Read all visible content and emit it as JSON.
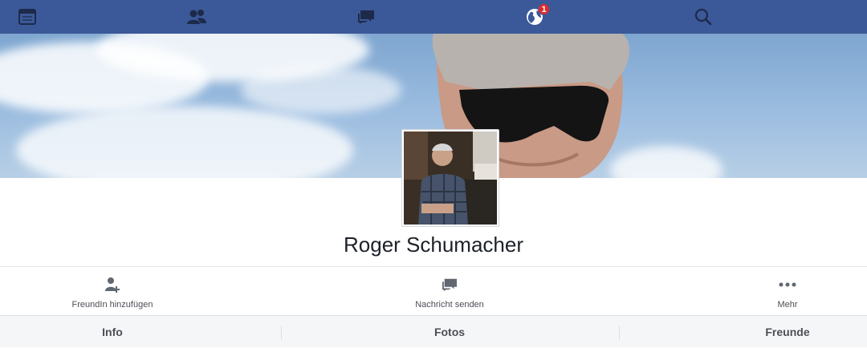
{
  "nav": {
    "items": [
      {
        "icon": "news-feed-icon"
      },
      {
        "icon": "friend-requests-icon"
      },
      {
        "icon": "messages-icon"
      },
      {
        "icon": "notifications-globe-icon",
        "badge": "1"
      },
      {
        "icon": "search-icon"
      }
    ],
    "background": "#3b5998"
  },
  "profile": {
    "name": "Roger Schumacher"
  },
  "actions": {
    "add_friend": "FreundIn hinzufügen",
    "message": "Nachricht senden",
    "more": "Mehr"
  },
  "tabs": {
    "info": "Info",
    "photos": "Fotos",
    "friends": "Freunde"
  }
}
